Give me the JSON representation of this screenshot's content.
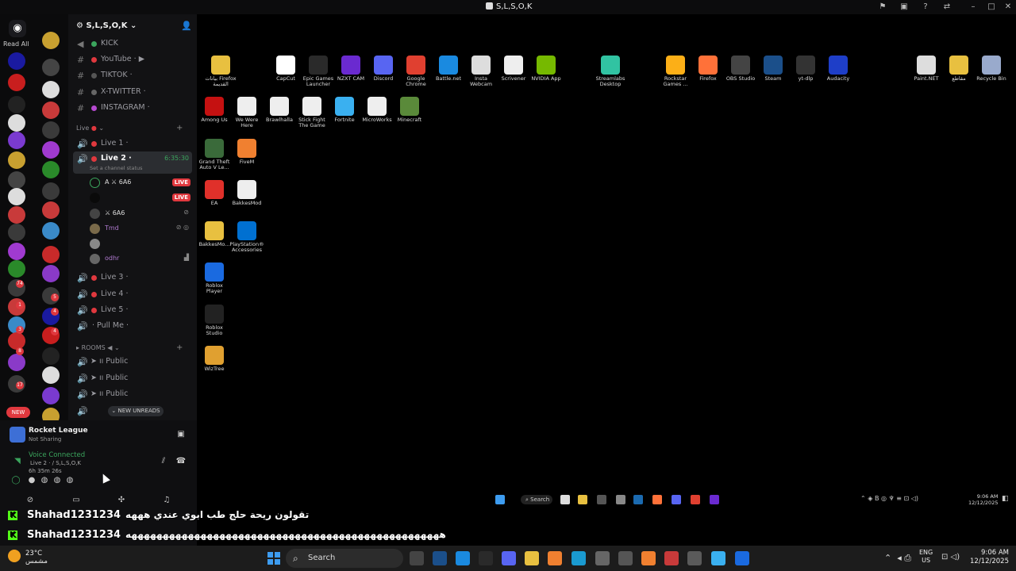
{
  "window": {
    "title": "S,L,S,O,K"
  },
  "rail": {
    "read_all": "Read All",
    "new_badge": "NEW",
    "badges": [
      "74",
      "1",
      "3",
      "8",
      "17",
      "5",
      "4",
      "4"
    ]
  },
  "guild": {
    "name": "S,L,S,O,K",
    "text_channels": [
      {
        "label": "KICK",
        "color": "#3ba55d"
      },
      {
        "label": "YouTube ·",
        "color": "#e0383e"
      },
      {
        "label": "TIKTOK ·",
        "color": "#555"
      },
      {
        "label": "X-TWITTER ·",
        "color": "#666"
      },
      {
        "label": "INSTAGRAM ·",
        "color": "#b64ad0"
      }
    ],
    "live_category": "Live",
    "voice_channels": [
      {
        "label": "Live 1 ·"
      },
      {
        "label": "Live 2 ·",
        "status": "Set a channel status",
        "timer": "6:35:30"
      }
    ],
    "users": [
      {
        "name": "A ⚔ 6A6",
        "live": "LIVE"
      },
      {
        "name": "",
        "live": "LIVE"
      },
      {
        "name": "⚔ 6A6",
        "live": ""
      },
      {
        "name": "Tmd",
        "live": ""
      },
      {
        "name": "",
        "live": ""
      },
      {
        "name": "odhr",
        "live": ""
      }
    ],
    "voice_channels_2": [
      {
        "label": "Live 3 ·"
      },
      {
        "label": "Live 4 ·"
      },
      {
        "label": "Live 5 ·"
      },
      {
        "label": "· Pull Me ·"
      }
    ],
    "rooms_category": "ROOMS",
    "rooms": [
      {
        "label": "Public"
      },
      {
        "label": "Public"
      },
      {
        "label": "Public"
      }
    ],
    "new_unreads": "NEW UNREADS"
  },
  "panel": {
    "activity": "Rocket League",
    "activity_sub": "Not Sharing",
    "voice_status": "Voice Connected",
    "voice_sub": "Live 2 · / S,L,S,O,K",
    "voice_time": "6h  35m  26s"
  },
  "chat": [
    {
      "user": "Shahad1231234",
      "message": "تقولون ريحة حلج طب ابوي عندي هههه"
    },
    {
      "user": "Shahad1231234",
      "message": "ههههههههههههههههههههههههههههههههههههههههههههههههههه"
    }
  ],
  "desktop_icons": [
    {
      "label": "بيانات Firefox القديمة",
      "color": "#e8c040"
    },
    {
      "label": "CapCut",
      "color": "#fff"
    },
    {
      "label": "Epic Games Launcher",
      "color": "#2a2a2a"
    },
    {
      "label": "NZXT CAM",
      "color": "#6a2ad0"
    },
    {
      "label": "Discord",
      "color": "#5865f2"
    },
    {
      "label": "Google Chrome",
      "color": "#e04030"
    },
    {
      "label": "Battle.net",
      "color": "#1a8ae0"
    },
    {
      "label": "Insta Webcam",
      "color": "#ddd"
    },
    {
      "label": "Scrivener",
      "color": "#eee"
    },
    {
      "label": "NVIDIA App",
      "color": "#76b900"
    },
    {
      "label": "Streamlabs Desktop",
      "color": "#31c3a2"
    },
    {
      "label": "Rockstar Games ...",
      "color": "#fcaf17"
    },
    {
      "label": "Firefox",
      "color": "#ff7139"
    },
    {
      "label": "OBS Studio",
      "color": "#444"
    },
    {
      "label": "Steam",
      "color": "#1b4f8a"
    },
    {
      "label": "yt-dlp",
      "color": "#333"
    },
    {
      "label": "Audacity",
      "color": "#1e3ec8"
    },
    {
      "label": "Paint.NET",
      "color": "#ddd"
    },
    {
      "label": "مقاطع",
      "color": "#e8c040"
    },
    {
      "label": "Recycle Bin",
      "color": "#9ac"
    },
    {
      "label": "Among Us",
      "color": "#c51111"
    },
    {
      "label": "We Were Here",
      "color": "#eee"
    },
    {
      "label": "Brawlhalla",
      "color": "#eee"
    },
    {
      "label": "Stick Fight The Game",
      "color": "#eee"
    },
    {
      "label": "Fortnite",
      "color": "#3ab0f0"
    },
    {
      "label": "MicroWorks",
      "color": "#eee"
    },
    {
      "label": "Minecraft",
      "color": "#5a8a3a"
    },
    {
      "label": "Grand Theft Auto V Le...",
      "color": "#3a6a3a"
    },
    {
      "label": "FiveM",
      "color": "#f08030"
    },
    {
      "label": "EA",
      "color": "#e0302a"
    },
    {
      "label": "BakkesMod",
      "color": "#eee"
    },
    {
      "label": "BakkesMo...",
      "color": "#e8c040"
    },
    {
      "label": "PlayStation® Accessories",
      "color": "#0070d1"
    },
    {
      "label": "Roblox Player",
      "color": "#1a6ae0"
    },
    {
      "label": "Roblox Studio",
      "color": "#222"
    },
    {
      "label": "WizTree",
      "color": "#e0a030"
    }
  ],
  "inner_taskbar": {
    "search": "Search",
    "time": "9:06 AM",
    "date": "12/12/2025"
  },
  "taskbar": {
    "weather_temp": "23°C",
    "weather_desc": "مشمس",
    "search": "Search",
    "lang": "ENG",
    "region": "US",
    "time": "9:06 AM",
    "date": "12/12/2025"
  }
}
